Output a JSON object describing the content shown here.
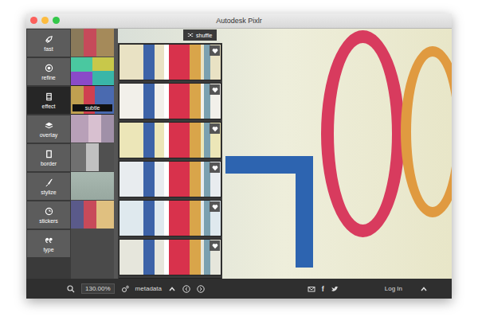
{
  "window": {
    "title": "Autodesk Pixlr"
  },
  "tools": [
    {
      "label": "fast",
      "selected": false
    },
    {
      "label": "refine",
      "selected": false
    },
    {
      "label": "effect",
      "selected": true
    },
    {
      "label": "overlay",
      "selected": false
    },
    {
      "label": "border",
      "selected": false
    },
    {
      "label": "stylize",
      "selected": false
    },
    {
      "label": "stickers",
      "selected": false
    },
    {
      "label": "type",
      "selected": false
    }
  ],
  "effect_thumbnails": [
    {
      "label": "",
      "selected": false
    },
    {
      "label": "",
      "selected": false
    },
    {
      "label": "subtle",
      "selected": true
    },
    {
      "label": "",
      "selected": false
    },
    {
      "label": "",
      "selected": false
    },
    {
      "label": "",
      "selected": false
    },
    {
      "label": "",
      "selected": false
    }
  ],
  "shuffle_button": {
    "label": "shuffle"
  },
  "variants": [
    {
      "tint": "#e9e2c4"
    },
    {
      "tint": "#f2f0ea"
    },
    {
      "tint": "#ece6b8"
    },
    {
      "tint": "#e8ecef"
    },
    {
      "tint": "#dfe9ee"
    },
    {
      "tint": "#e6e6dc"
    },
    {
      "tint": "#ebe5d0"
    }
  ],
  "bottom_bar": {
    "zoom": "130.00%",
    "metadata": "metadata",
    "facebook": "f",
    "login": "Log In"
  }
}
